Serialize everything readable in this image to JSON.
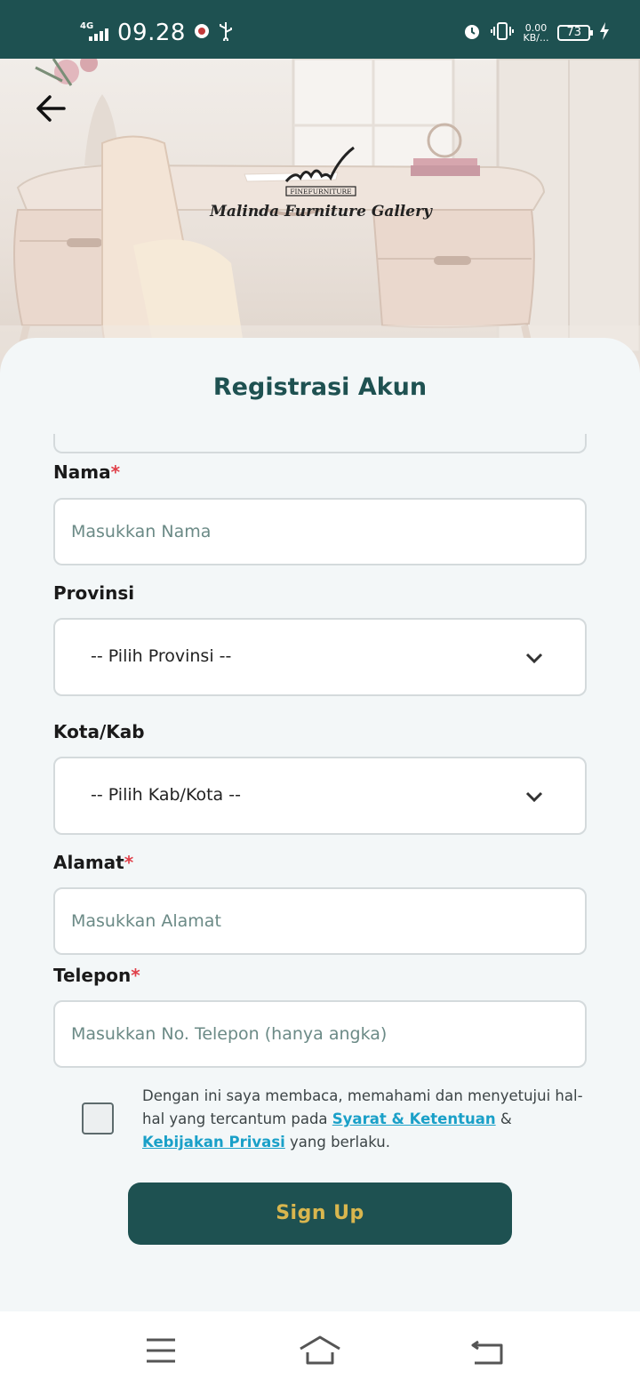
{
  "status_bar": {
    "network": "4G",
    "time": "09.28",
    "speed_value": "0.00",
    "speed_unit": "KB/...",
    "battery": "73"
  },
  "header": {
    "logo_tag": "FINEFURNITURE",
    "logo_name": "Malinda Furniture Gallery"
  },
  "form": {
    "title": "Registrasi Akun",
    "nama": {
      "label": "Nama",
      "required": "*",
      "placeholder": "Masukkan Nama"
    },
    "provinsi": {
      "label": "Provinsi",
      "selected": "-- Pilih Provinsi --"
    },
    "kota": {
      "label": "Kota/Kab",
      "selected": "-- Pilih Kab/Kota --"
    },
    "alamat": {
      "label": "Alamat",
      "required": "*",
      "placeholder": "Masukkan Alamat"
    },
    "telepon": {
      "label": "Telepon",
      "required": "*",
      "placeholder": "Masukkan No. Telepon (hanya angka)"
    },
    "terms": {
      "text_before": "Dengan ini saya membaca, memahami dan menyetujui hal-hal yang tercantum pada ",
      "link_terms": "Syarat & Ketentuan",
      "connector": " & ",
      "link_privacy": "Kebijakan Privasi",
      "text_after": " yang berlaku."
    },
    "submit_label": "Sign Up"
  },
  "colors": {
    "primary": "#1e5151",
    "accent_gold": "#d9b64e",
    "link": "#1aa0c8",
    "required": "#e0404a"
  }
}
